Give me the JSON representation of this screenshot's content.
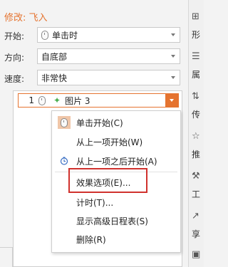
{
  "panel": {
    "title": "修改: 飞入",
    "start": {
      "label": "开始:",
      "value": "单击时"
    },
    "direction": {
      "label": "方向:",
      "value": "自底部"
    },
    "speed": {
      "label": "速度:",
      "value": "非常快"
    }
  },
  "animation_list": {
    "items": [
      {
        "number": "1",
        "name": "图片 3"
      }
    ]
  },
  "context_menu": {
    "items": [
      {
        "label": "单击开始(C)",
        "icon": "mouse-click-icon"
      },
      {
        "label": "从上一项开始(W)",
        "icon": ""
      },
      {
        "label": "从上一项之后开始(A)",
        "icon": "clock-icon"
      },
      {
        "label": "效果选项(E)...",
        "icon": ""
      },
      {
        "label": "计时(T)...",
        "icon": ""
      },
      {
        "label": "显示高级日程表(S)",
        "icon": ""
      },
      {
        "label": "删除(R)",
        "icon": ""
      }
    ]
  },
  "right_rail": {
    "items": [
      "形",
      "属",
      "传",
      "推",
      "工",
      "享"
    ]
  },
  "colors": {
    "accent": "#e5732f",
    "highlight_box": "#d0312d"
  }
}
